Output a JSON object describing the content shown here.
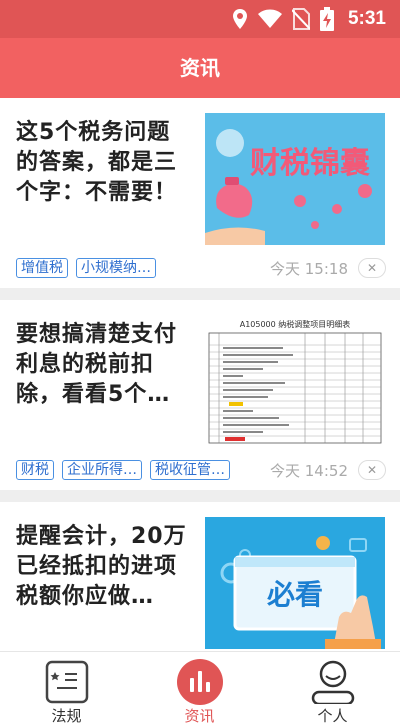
{
  "status_bar": {
    "time": "5:31"
  },
  "app_bar": {
    "title": "资讯"
  },
  "articles": [
    {
      "title": "这5个税务问题的答案，都是三个字：不需要！",
      "thumb_text": "财税锦囊",
      "tags": [
        "增值税",
        "小规模纳…"
      ],
      "time": "今天 15:18"
    },
    {
      "title": "要想搞清楚支付利息的税前扣除，看看5个…",
      "thumb_text": "A105000 纳税调整项目明细表",
      "tags": [
        "财税",
        "企业所得…",
        "税收征管…"
      ],
      "time": "今天 14:52"
    },
    {
      "title": "提醒会计，20万已经抵扣的进项税额你应做…",
      "thumb_text": "必看",
      "tags": [],
      "time": ""
    }
  ],
  "tabs": [
    {
      "label": "法规",
      "icon": "law-book-icon",
      "active": false
    },
    {
      "label": "资讯",
      "icon": "news-chart-icon",
      "active": true
    },
    {
      "label": "个人",
      "icon": "person-icon",
      "active": false
    }
  ],
  "colors": {
    "header": "#f26161",
    "accent": "#e05555",
    "tag_border": "#4a90e2"
  },
  "close_glyph": "✕"
}
